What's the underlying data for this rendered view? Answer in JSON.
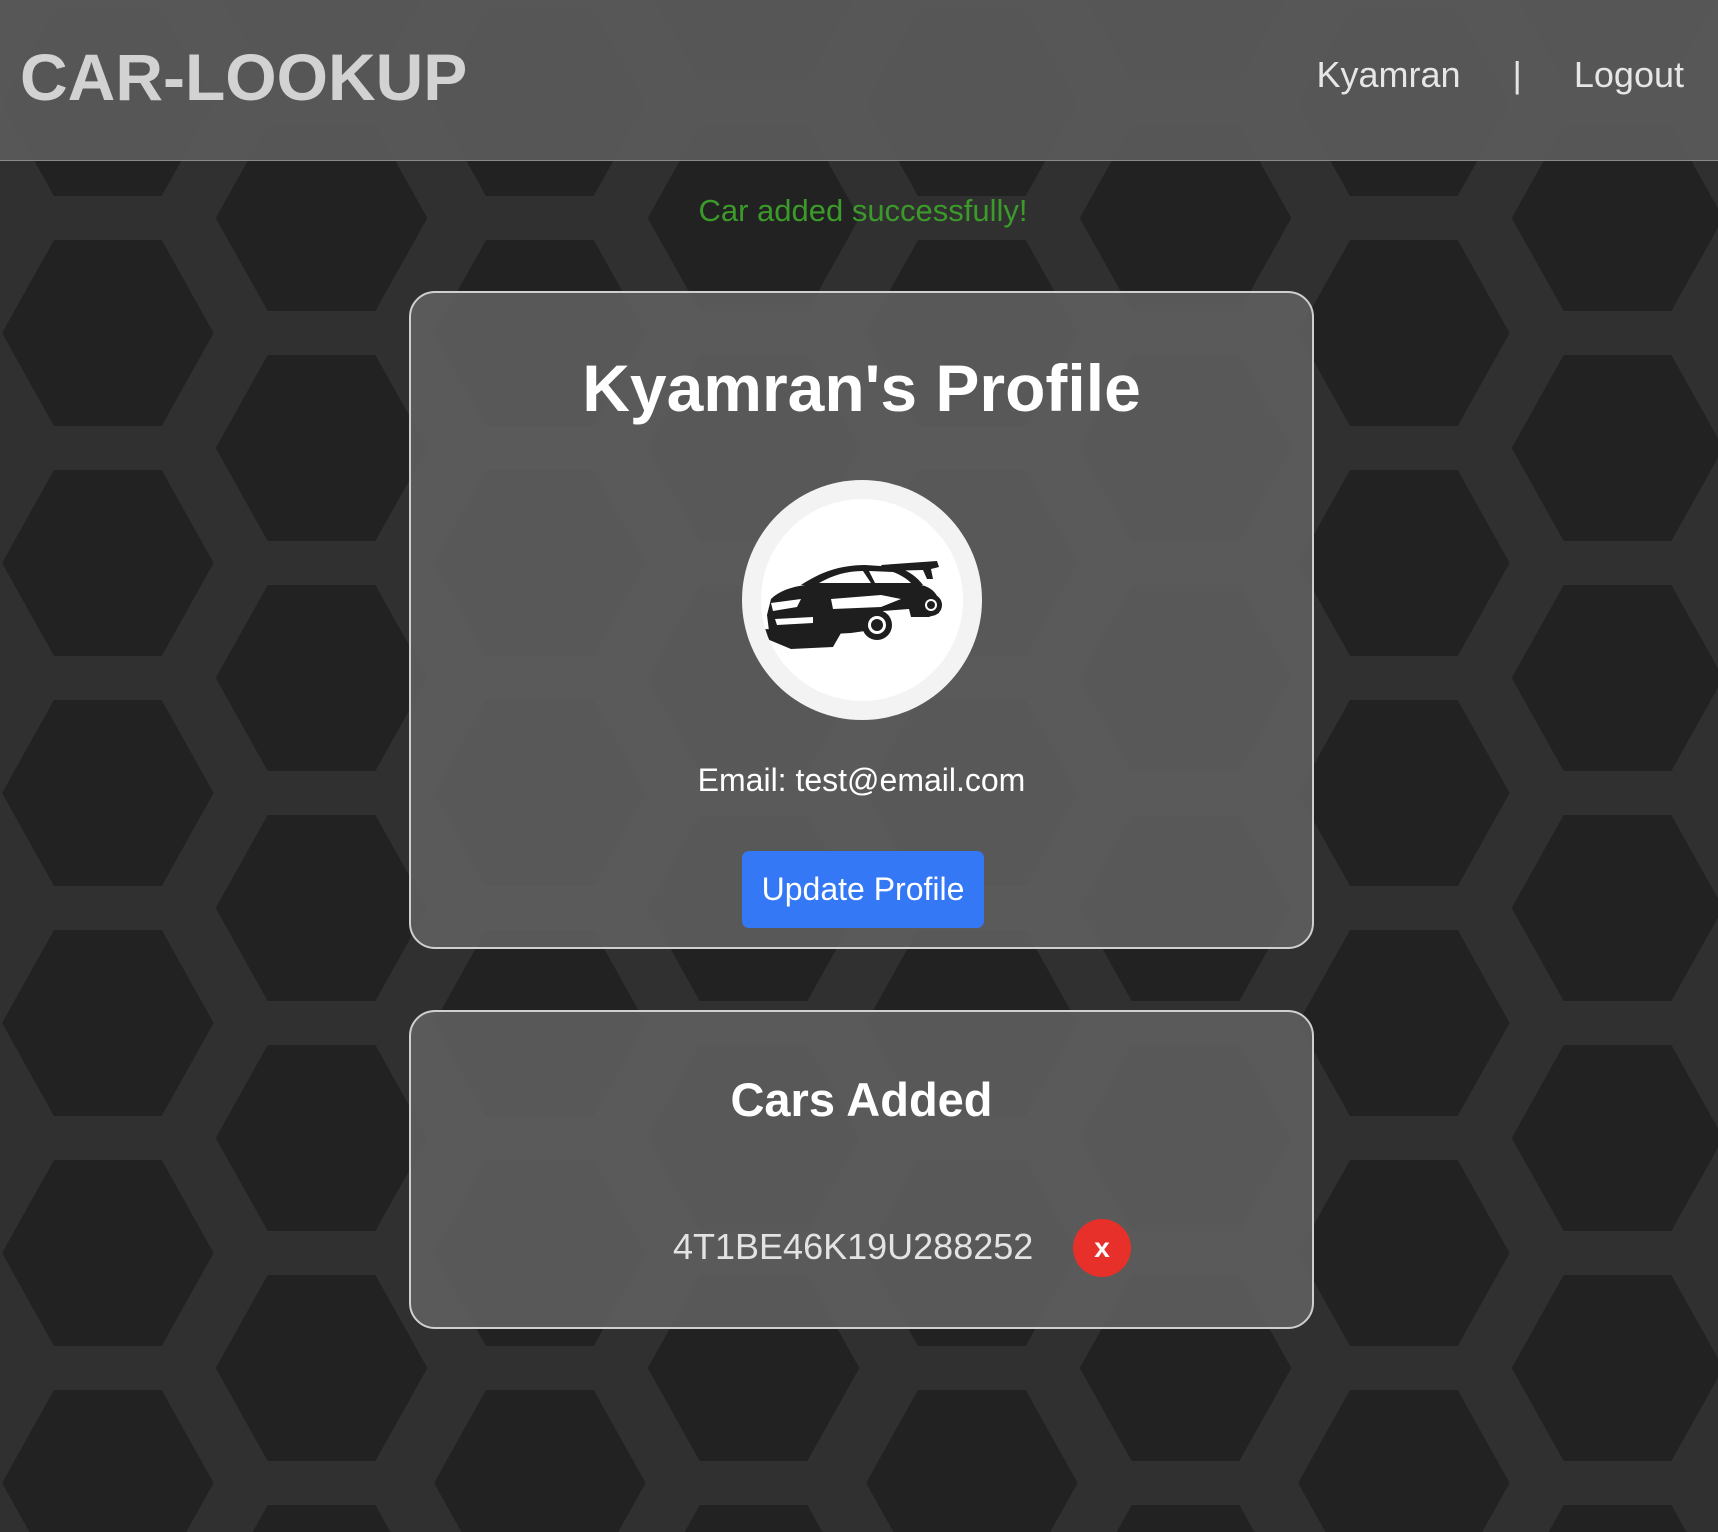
{
  "header": {
    "brand": "CAR-LOOKUP",
    "username": "Kyamran",
    "separator": "|",
    "logout_label": "Logout"
  },
  "flash": {
    "message": "Car added successfully!",
    "color": "#3b9a2a"
  },
  "profile": {
    "title": "Kyamran's Profile",
    "avatar_icon": "sports-car-icon",
    "email_line": "Email: test@email.com",
    "update_button_label": "Update Profile",
    "button_color": "#3478f6"
  },
  "cars": {
    "title": "Cars Added",
    "items": [
      {
        "vin": "4T1BE46K19U288252",
        "remove_label": "x"
      }
    ],
    "remove_color": "#e8302a"
  }
}
